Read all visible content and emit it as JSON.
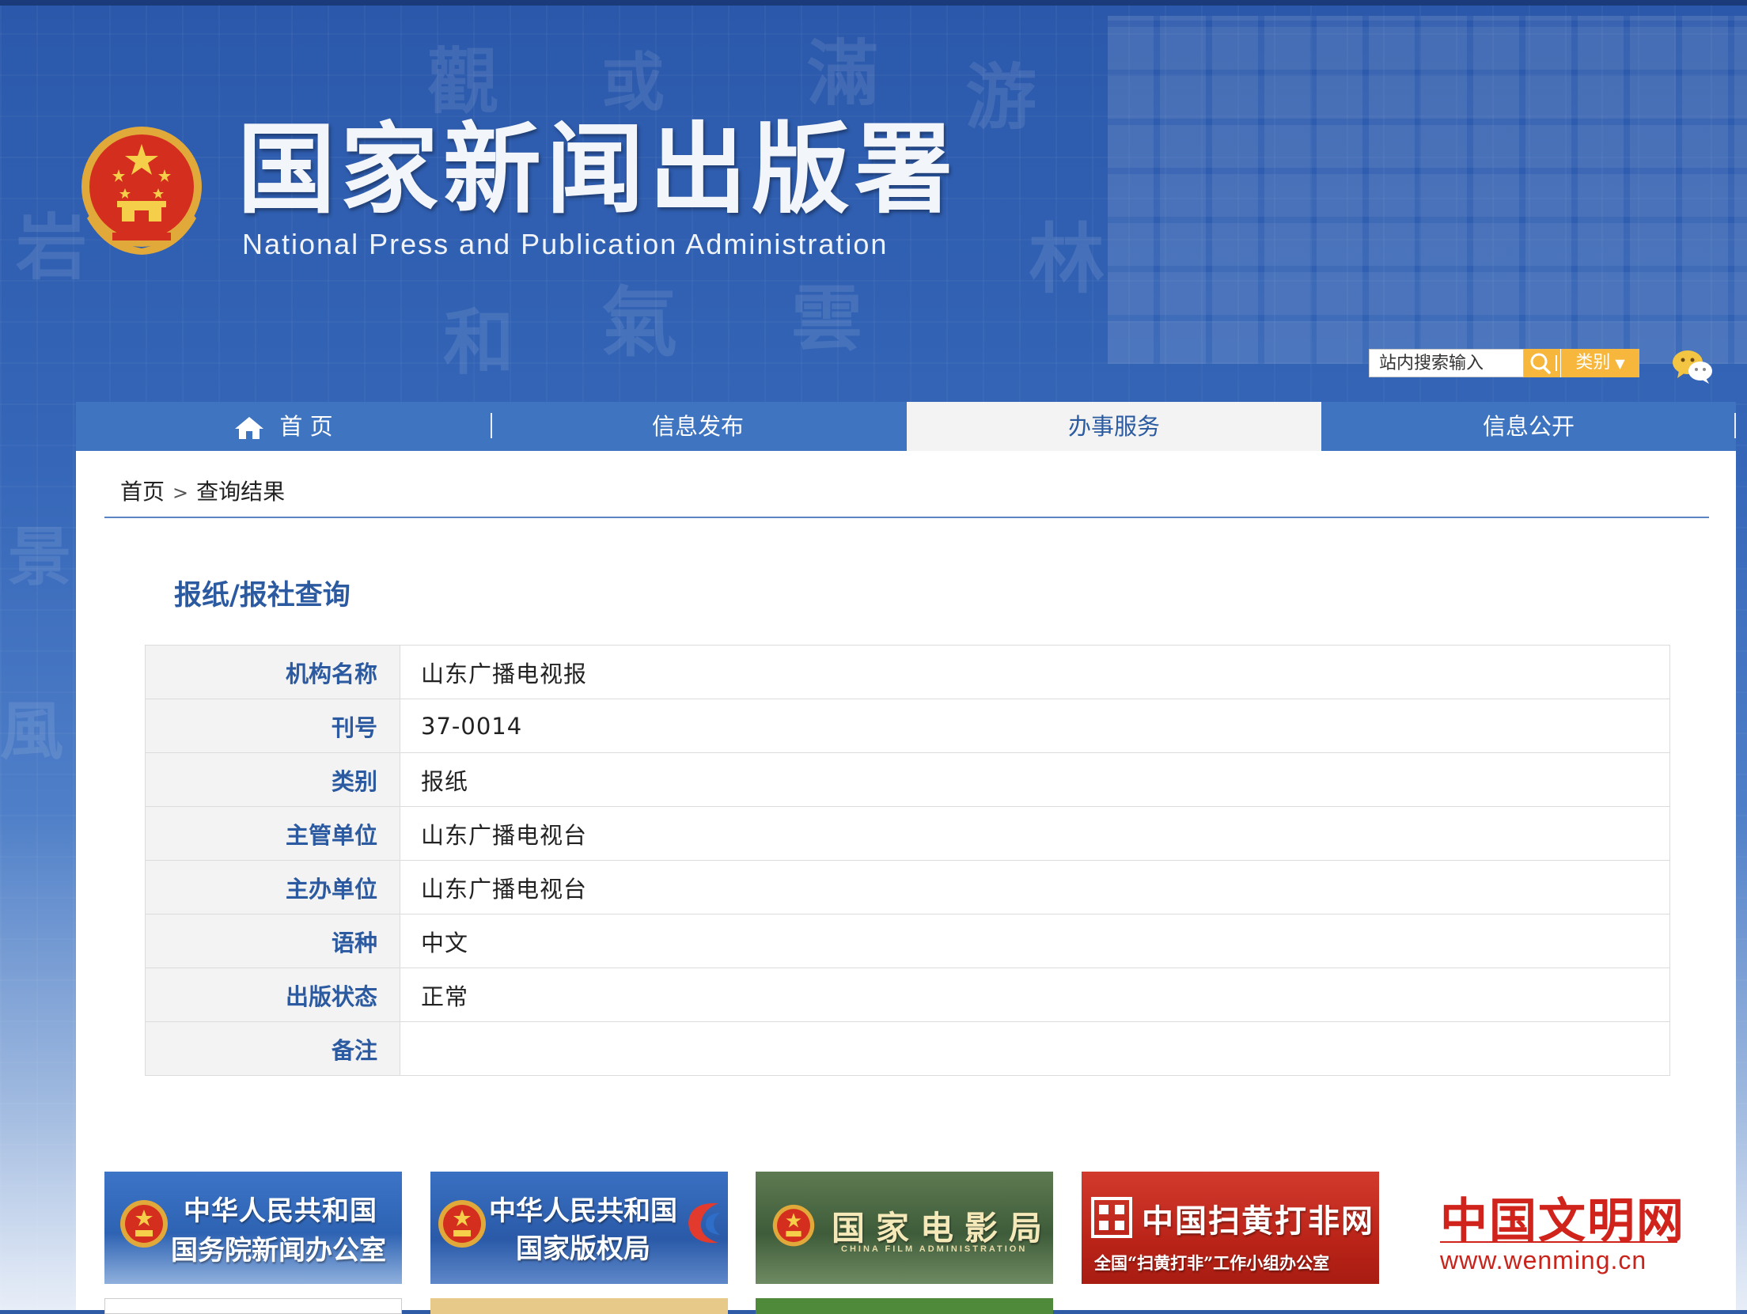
{
  "header": {
    "site_title": "国家新闻出版署",
    "site_subtitle": "National  Press and Publication Administration",
    "logo_icon": "national-emblem-icon"
  },
  "search": {
    "placeholder": "站内搜索输入",
    "search_icon": "search-icon",
    "category_label": "类别",
    "wechat_icon": "wechat-icon"
  },
  "nav": {
    "items": [
      {
        "label": "首 页",
        "icon": "home-icon",
        "active": false
      },
      {
        "label": "信息发布",
        "active": false
      },
      {
        "label": "办事服务",
        "active": true
      },
      {
        "label": "信息公开",
        "active": false
      }
    ]
  },
  "breadcrumb": {
    "home": "首页",
    "separator": ">",
    "current": "查询结果"
  },
  "page_title": "报纸/报社查询",
  "record": [
    {
      "label": "机构名称",
      "value": "山东广播电视报"
    },
    {
      "label": "刊号",
      "value": "37-0014"
    },
    {
      "label": "类别",
      "value": "报纸"
    },
    {
      "label": "主管单位",
      "value": "山东广播电视台"
    },
    {
      "label": "主办单位",
      "value": "山东广播电视台"
    },
    {
      "label": "语种",
      "value": "中文"
    },
    {
      "label": "出版状态",
      "value": "正常"
    },
    {
      "label": "备注",
      "value": ""
    }
  ],
  "footer_links": [
    {
      "line1": "中华人民共和国",
      "line2": "国务院新闻办公室"
    },
    {
      "line1": "中华人民共和国",
      "line2": "国家版权局"
    },
    {
      "line1": "国家电影局",
      "line2": "CHINA FILM ADMINISTRATION"
    },
    {
      "line1": "中国扫黄打非网",
      "line2": "全国“扫黄打非”工作小组办公室"
    },
    {
      "line1": "中国文明网",
      "line2": "www.wenming.cn"
    }
  ],
  "colors": {
    "brand_blue": "#2c5aa0",
    "nav_blue": "#3f74c0",
    "search_accent": "#f6b73c",
    "wenming_red": "#d0231b"
  }
}
